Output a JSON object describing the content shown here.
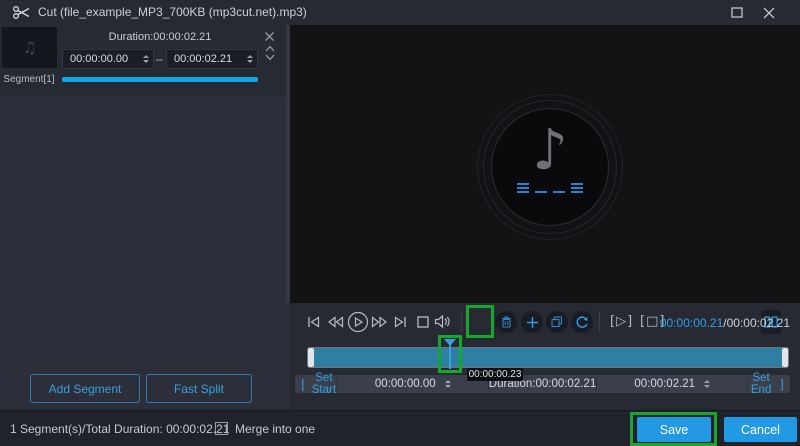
{
  "colors": {
    "accent_blue": "#2f9fe5",
    "button_blue": "#2399e3",
    "segment_bar_cyan": "#14a3e8",
    "timeline_fill": "#2f7fa2",
    "annotation_green": "#17a72e"
  },
  "title_bar": {
    "title": "Cut (file_example_MP3_700KB (mp3cut.net).mp3)"
  },
  "segment_panel": {
    "segment_label": "Segment[1]",
    "duration_label": "Duration:00:00:02.21",
    "start_value": "00:00:00.00",
    "range_separator": "–",
    "end_value": "00:00:02.21",
    "add_segment_label": "Add Segment",
    "fast_split_label": "Fast Split"
  },
  "transport": {
    "play_segment_glyph": "[▷]",
    "stop_segment_glyph": "[□]",
    "time_current": "00:00:00.21",
    "time_total": "/00:00:02.21"
  },
  "timeline": {
    "tooltip": "00:00:00.23"
  },
  "trim_bar": {
    "bracket_open": "[",
    "set_start_label": "Set Start",
    "start_value": "00:00:00.00",
    "duration_label": "Duration:00:00:02.21",
    "end_value": "00:00:02.21",
    "set_end_label": "Set End",
    "bracket_close": "]"
  },
  "footer": {
    "summary": "1 Segment(s)/Total Duration: 00:00:02.21",
    "merge_label": "Merge into one",
    "save_label": "Save",
    "cancel_label": "Cancel"
  }
}
